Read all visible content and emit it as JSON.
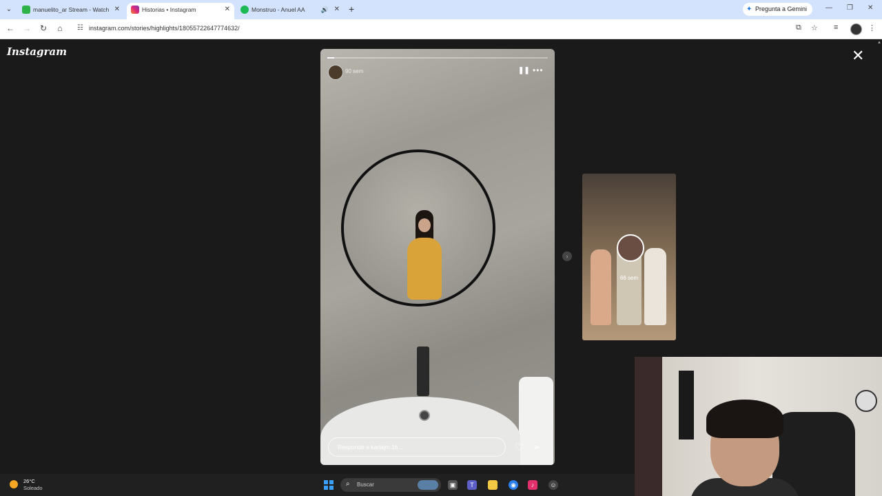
{
  "browser": {
    "tabs": [
      {
        "title": "manuelito_ar Stream - Watch L",
        "favicon_color": "#2db34a",
        "active": false
      },
      {
        "title": "Historias • Instagram",
        "favicon_color": "#d6249f",
        "active": true
      },
      {
        "title": "Monstruo - Anuel AA",
        "favicon_color": "#1db954",
        "active": false
      }
    ],
    "new_tab_glyph": "+",
    "gemini_label": "Pregunta a Gemini",
    "url": "instagram.com/stories/highlights/18055722647774632/"
  },
  "instagram": {
    "logo": "Instagram",
    "story": {
      "time": "90 sem",
      "progress": 0.03,
      "reply_placeholder": "Responde a karlajm.16..."
    },
    "next_story": {
      "time": "66 sem"
    }
  },
  "taskbar": {
    "weather": {
      "temp": "26°C",
      "condition": "Soleado"
    },
    "search_placeholder": "Buscar"
  },
  "colors": {
    "accent": "#1a73e8",
    "page_bg": "#1a1a1a",
    "tab_strip": "#d3e3fd"
  }
}
